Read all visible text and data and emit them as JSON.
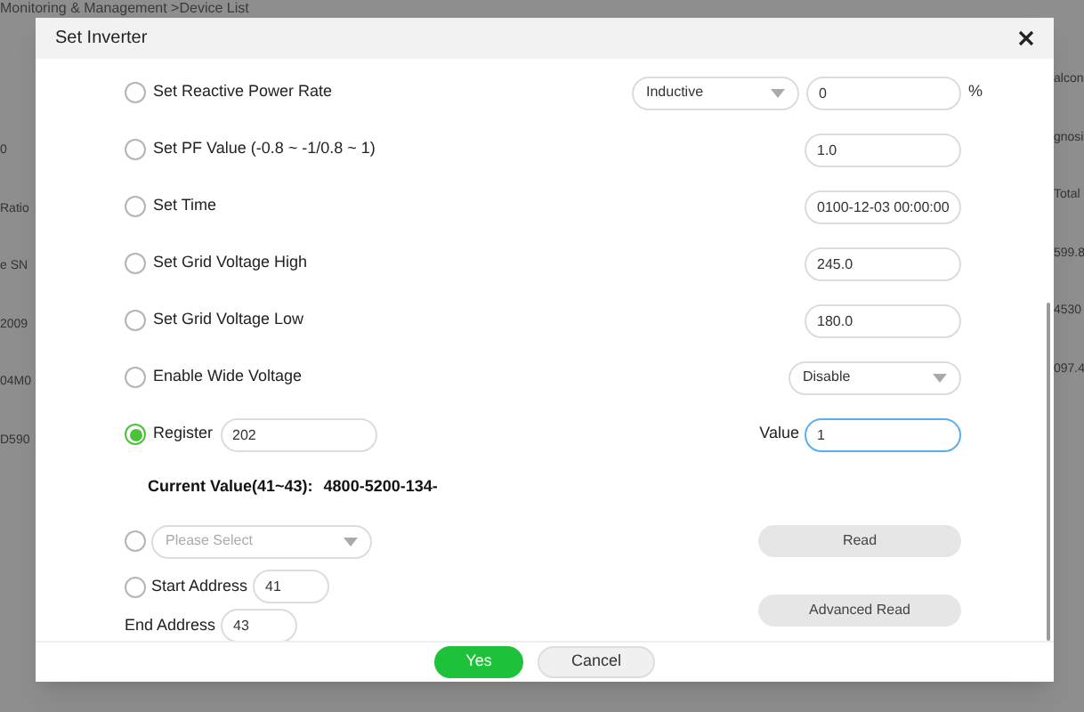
{
  "background": {
    "breadcrumb": "Monitoring & Management >Device List",
    "left_fragments": [
      "0",
      "Ratio",
      "e SN",
      "2009",
      "04M0",
      "D590"
    ],
    "right_fragments": [
      "alcon",
      "gnosi",
      "Total",
      "599.8",
      "4530",
      "097.4"
    ]
  },
  "dialog": {
    "title": "Set Inverter",
    "settings": [
      {
        "kind": "select-input",
        "label": "Set Reactive Power Rate",
        "selected": false,
        "option": "Inductive",
        "value": "0",
        "unit": "%"
      },
      {
        "kind": "input",
        "label": "Set PF Value (-0.8 ~ -1/0.8 ~ 1)",
        "selected": false,
        "value": "1.0"
      },
      {
        "kind": "input",
        "label": "Set Time",
        "selected": false,
        "value": "0100-12-03 00:00:00"
      },
      {
        "kind": "input",
        "label": "Set Grid Voltage High",
        "selected": false,
        "value": "245.0"
      },
      {
        "kind": "input",
        "label": "Set Grid Voltage Low",
        "selected": false,
        "value": "180.0"
      },
      {
        "kind": "select",
        "label": "Enable Wide Voltage",
        "selected": false,
        "option": "Disable"
      },
      {
        "kind": "register",
        "label": "Register",
        "selected": true,
        "register": "202",
        "value_label": "Value",
        "value": "1",
        "focused": true
      }
    ],
    "current_value": {
      "label": "Current Value(41~43):",
      "value": "4800-5200-134-"
    },
    "read": [
      {
        "kind": "select-read",
        "selected": false,
        "placeholder": "Please Select",
        "button": "Read"
      },
      {
        "kind": "address",
        "selected": false,
        "start_label": "Start Address",
        "start": "41",
        "end_label": "End Address",
        "end": "43",
        "button": "Advanced Read"
      }
    ],
    "buttons": [
      {
        "label": "Yes",
        "primary": true
      },
      {
        "label": "Cancel",
        "primary": false
      }
    ]
  }
}
